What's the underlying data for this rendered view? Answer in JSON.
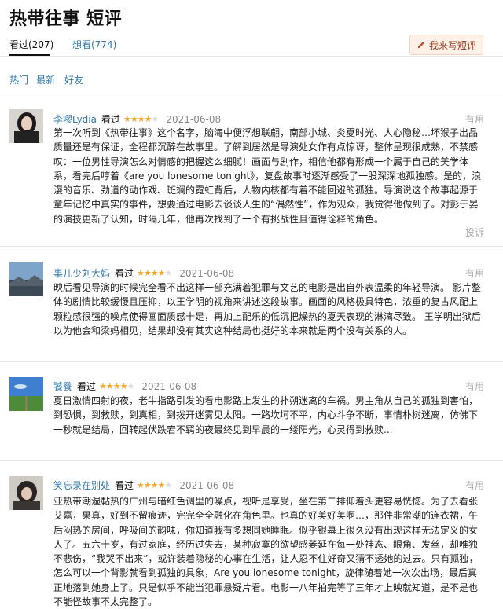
{
  "page": {
    "title": "热带往事 短评"
  },
  "tabs": [
    {
      "label": "看过(207)",
      "active": true
    },
    {
      "label": "想看(774)",
      "active": false
    }
  ],
  "write_button": {
    "label": "我来写短评",
    "icon": "pencil-icon"
  },
  "sort": [
    "热门",
    "最新",
    "好友"
  ],
  "reviews": [
    {
      "user": "李嘐Lydia",
      "status": "看过",
      "stars": 4,
      "date": "2021-06-08",
      "useful": "有用",
      "report": "投诉",
      "text": "第一次听到《热带往事》这个名字，脑海中便浮想联翩，南部小城、炎夏时光、人心隐秘…坏猴子出品质量还是有保证，全程都沉醉在故事里。了解到居然是导演处女作有点惊讶，整体呈现很成熟，不禁感叹：一位男性导演怎么对情感的把握这么细腻！画面与剧作，相信他都有形成一个属于自己的美学体系，看完后哼着《are you lonesome tonight》，复盘故事时逐渐感受了一股深深地孤独感。是的，浪漫的音乐、劲道的动作戏、斑斓的霓虹背后，人物内核都有着不能回避的孤独。导演说这个故事起源于童年记忆中真实的事件，想要通过电影去谈谈人生的“偶然性”，作为观众，我觉得他做到了。对彭于晏的演技更新了认知，时隔几年，他再次找到了一个有挑战性且值得诠释的角色。"
    },
    {
      "user": "事儿少刘大妈",
      "status": "看过",
      "stars": 4,
      "date": "2021-06-08",
      "useful": "有用",
      "text": "映后看见导演的时候完全看不出这样一部充满着犯罪与文艺的电影是出自外表温柔的年轻导演。 影片整体的剧情比较缓慢且压抑，以王学明的视角来讲述这段故事。画面的风格极具特色，浓重的复古风配上颗粒感很强的噪点使得画面质感十足，再加上配乐的低沉把燥热的夏天表现的淋漓尽致。 王学明出狱后以为他会和梁妈相见，结果却没有其实这种结局也挺好的本来就是两个没有关系的人。"
    },
    {
      "user": "饕餮",
      "status": "看过",
      "stars": 4,
      "date": "2021-06-08",
      "useful": "有用",
      "text": "夏日激情四射的夜，老牛指路引发的看电影路上发生的扑朔迷离的车祸。男主角从自己的孤独到害怕，到恐惧，到救赎，到真相，到拨开迷雾见太阳。一路坎坷不平，内心斗争不断，事情朴树迷离，仿佛下一秒就是结局，回转起伏跌宕不羁的夜最终见到早晨的一缕阳光，心灵得到救赎..."
    },
    {
      "user": "笑忘录在别处",
      "status": "看过",
      "stars": 4,
      "date": "2021-06-08",
      "useful": "有用",
      "text": "亚热带潮湿黏热的广州与暗红色调里的噪点，视听是享受，坐在第二排仰着头更容易恍惚。为了去看张艾嘉，果真，好到不留痕迹，完完全全融化在角色里。也真的好美好美啊…，那件非常潮的连衣裙，午后闷热的房间，呼吸间的韵味，你知道我有多想同她睡眠。似乎银幕上很久没有出现这样无法定义的女人了。五六十岁，有过家庭，经历过失去，某种寂寞的欲望感萎延在每一处神态、眼角、发丝，却唯独不悲伤，“我哭不出来”，或许装着隐秘的心事在生活，让人忍不住好奇又猜不透她的过去。只有孤独，怎么可以一个背影就看到孤独的具象，Are you lonesome tonight，旋律随着她一次次出场，最后真正地落到她身上了。只是似乎不能当犯罪悬疑片看。电影一八年拍完等了三年才上映就知道，是不是也不能怪故事不太完整了。"
    }
  ],
  "colors": {
    "link": "#3377aa",
    "star": "#f4a82f",
    "button_bg": "#fff1e7",
    "button_text": "#9b3c20"
  }
}
